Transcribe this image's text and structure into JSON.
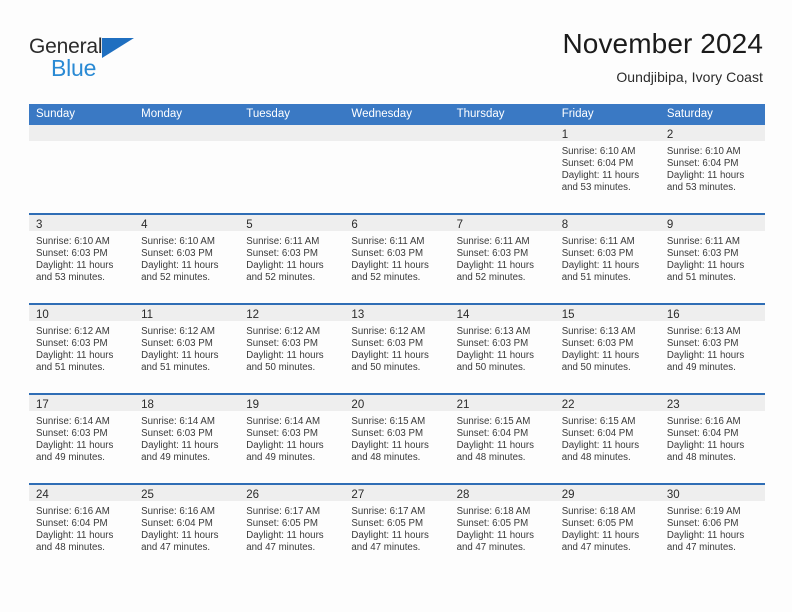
{
  "brand": {
    "name_part1": "General",
    "name_part2": "Blue",
    "accent_color": "#1f6fc0",
    "accent_color_light": "#2a8ad4"
  },
  "header": {
    "title": "November 2024",
    "subtitle": "Oundjibipa, Ivory Coast"
  },
  "theme": {
    "header_blue": "#3a79c4",
    "row_separator_blue": "#2f6db5",
    "daynum_band_gray": "#eeeeee",
    "page_background": "#fdfdfd"
  },
  "weekdays": [
    "Sunday",
    "Monday",
    "Tuesday",
    "Wednesday",
    "Thursday",
    "Friday",
    "Saturday"
  ],
  "weeks": [
    [
      {
        "day": "",
        "empty": true
      },
      {
        "day": "",
        "empty": true
      },
      {
        "day": "",
        "empty": true
      },
      {
        "day": "",
        "empty": true
      },
      {
        "day": "",
        "empty": true
      },
      {
        "day": "1",
        "sunrise": "Sunrise: 6:10 AM",
        "sunset": "Sunset: 6:04 PM",
        "daylight": "Daylight: 11 hours and 53 minutes."
      },
      {
        "day": "2",
        "sunrise": "Sunrise: 6:10 AM",
        "sunset": "Sunset: 6:04 PM",
        "daylight": "Daylight: 11 hours and 53 minutes."
      }
    ],
    [
      {
        "day": "3",
        "sunrise": "Sunrise: 6:10 AM",
        "sunset": "Sunset: 6:03 PM",
        "daylight": "Daylight: 11 hours and 53 minutes."
      },
      {
        "day": "4",
        "sunrise": "Sunrise: 6:10 AM",
        "sunset": "Sunset: 6:03 PM",
        "daylight": "Daylight: 11 hours and 52 minutes."
      },
      {
        "day": "5",
        "sunrise": "Sunrise: 6:11 AM",
        "sunset": "Sunset: 6:03 PM",
        "daylight": "Daylight: 11 hours and 52 minutes."
      },
      {
        "day": "6",
        "sunrise": "Sunrise: 6:11 AM",
        "sunset": "Sunset: 6:03 PM",
        "daylight": "Daylight: 11 hours and 52 minutes."
      },
      {
        "day": "7",
        "sunrise": "Sunrise: 6:11 AM",
        "sunset": "Sunset: 6:03 PM",
        "daylight": "Daylight: 11 hours and 52 minutes."
      },
      {
        "day": "8",
        "sunrise": "Sunrise: 6:11 AM",
        "sunset": "Sunset: 6:03 PM",
        "daylight": "Daylight: 11 hours and 51 minutes."
      },
      {
        "day": "9",
        "sunrise": "Sunrise: 6:11 AM",
        "sunset": "Sunset: 6:03 PM",
        "daylight": "Daylight: 11 hours and 51 minutes."
      }
    ],
    [
      {
        "day": "10",
        "sunrise": "Sunrise: 6:12 AM",
        "sunset": "Sunset: 6:03 PM",
        "daylight": "Daylight: 11 hours and 51 minutes."
      },
      {
        "day": "11",
        "sunrise": "Sunrise: 6:12 AM",
        "sunset": "Sunset: 6:03 PM",
        "daylight": "Daylight: 11 hours and 51 minutes."
      },
      {
        "day": "12",
        "sunrise": "Sunrise: 6:12 AM",
        "sunset": "Sunset: 6:03 PM",
        "daylight": "Daylight: 11 hours and 50 minutes."
      },
      {
        "day": "13",
        "sunrise": "Sunrise: 6:12 AM",
        "sunset": "Sunset: 6:03 PM",
        "daylight": "Daylight: 11 hours and 50 minutes."
      },
      {
        "day": "14",
        "sunrise": "Sunrise: 6:13 AM",
        "sunset": "Sunset: 6:03 PM",
        "daylight": "Daylight: 11 hours and 50 minutes."
      },
      {
        "day": "15",
        "sunrise": "Sunrise: 6:13 AM",
        "sunset": "Sunset: 6:03 PM",
        "daylight": "Daylight: 11 hours and 50 minutes."
      },
      {
        "day": "16",
        "sunrise": "Sunrise: 6:13 AM",
        "sunset": "Sunset: 6:03 PM",
        "daylight": "Daylight: 11 hours and 49 minutes."
      }
    ],
    [
      {
        "day": "17",
        "sunrise": "Sunrise: 6:14 AM",
        "sunset": "Sunset: 6:03 PM",
        "daylight": "Daylight: 11 hours and 49 minutes."
      },
      {
        "day": "18",
        "sunrise": "Sunrise: 6:14 AM",
        "sunset": "Sunset: 6:03 PM",
        "daylight": "Daylight: 11 hours and 49 minutes."
      },
      {
        "day": "19",
        "sunrise": "Sunrise: 6:14 AM",
        "sunset": "Sunset: 6:03 PM",
        "daylight": "Daylight: 11 hours and 49 minutes."
      },
      {
        "day": "20",
        "sunrise": "Sunrise: 6:15 AM",
        "sunset": "Sunset: 6:03 PM",
        "daylight": "Daylight: 11 hours and 48 minutes."
      },
      {
        "day": "21",
        "sunrise": "Sunrise: 6:15 AM",
        "sunset": "Sunset: 6:04 PM",
        "daylight": "Daylight: 11 hours and 48 minutes."
      },
      {
        "day": "22",
        "sunrise": "Sunrise: 6:15 AM",
        "sunset": "Sunset: 6:04 PM",
        "daylight": "Daylight: 11 hours and 48 minutes."
      },
      {
        "day": "23",
        "sunrise": "Sunrise: 6:16 AM",
        "sunset": "Sunset: 6:04 PM",
        "daylight": "Daylight: 11 hours and 48 minutes."
      }
    ],
    [
      {
        "day": "24",
        "sunrise": "Sunrise: 6:16 AM",
        "sunset": "Sunset: 6:04 PM",
        "daylight": "Daylight: 11 hours and 48 minutes."
      },
      {
        "day": "25",
        "sunrise": "Sunrise: 6:16 AM",
        "sunset": "Sunset: 6:04 PM",
        "daylight": "Daylight: 11 hours and 47 minutes."
      },
      {
        "day": "26",
        "sunrise": "Sunrise: 6:17 AM",
        "sunset": "Sunset: 6:05 PM",
        "daylight": "Daylight: 11 hours and 47 minutes."
      },
      {
        "day": "27",
        "sunrise": "Sunrise: 6:17 AM",
        "sunset": "Sunset: 6:05 PM",
        "daylight": "Daylight: 11 hours and 47 minutes."
      },
      {
        "day": "28",
        "sunrise": "Sunrise: 6:18 AM",
        "sunset": "Sunset: 6:05 PM",
        "daylight": "Daylight: 11 hours and 47 minutes."
      },
      {
        "day": "29",
        "sunrise": "Sunrise: 6:18 AM",
        "sunset": "Sunset: 6:05 PM",
        "daylight": "Daylight: 11 hours and 47 minutes."
      },
      {
        "day": "30",
        "sunrise": "Sunrise: 6:19 AM",
        "sunset": "Sunset: 6:06 PM",
        "daylight": "Daylight: 11 hours and 47 minutes."
      }
    ]
  ]
}
